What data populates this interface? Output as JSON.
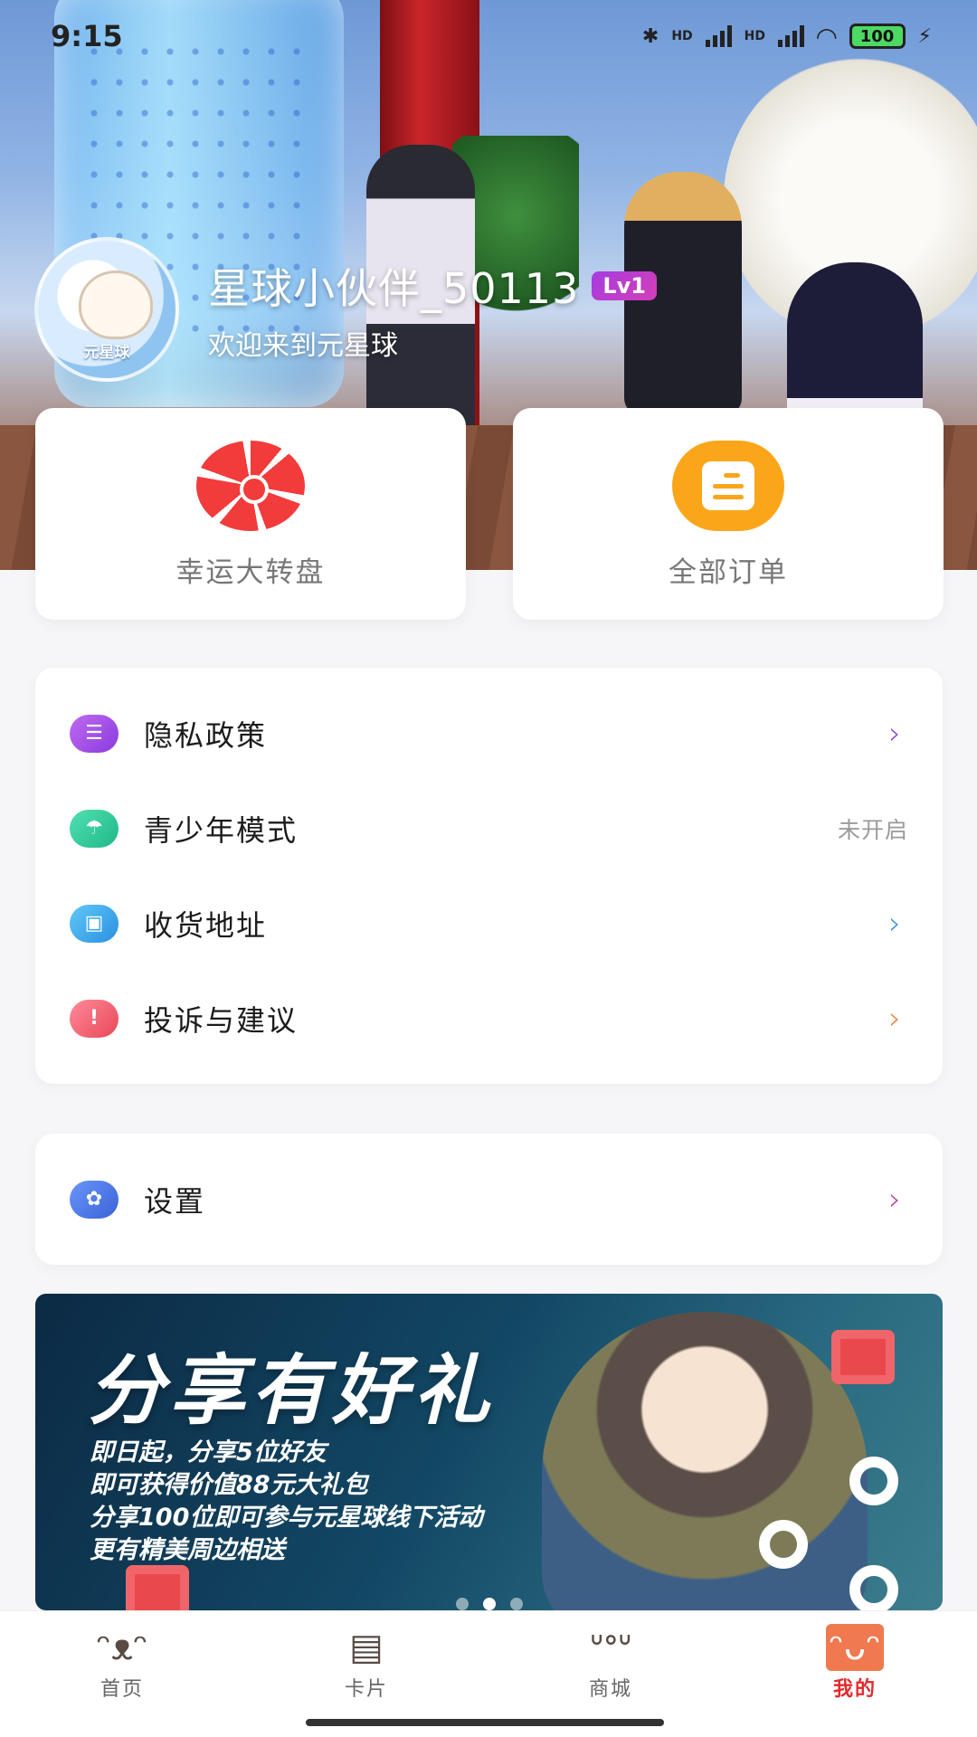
{
  "status_bar": {
    "time": "9:15",
    "battery": "100",
    "network_labels": [
      "HD",
      "HD"
    ]
  },
  "profile": {
    "username": "星球小伙伴_50113",
    "level": "Lv1",
    "welcome": "欢迎来到元星球",
    "avatar_logo_text": "元星球"
  },
  "quick_actions": [
    {
      "label": "幸运大转盘",
      "icon": "wheel-icon",
      "color": "#f23b3b"
    },
    {
      "label": "全部订单",
      "icon": "orders-icon",
      "color": "#fba61a"
    }
  ],
  "menu": {
    "items": [
      {
        "label": "隐私政策",
        "value": "",
        "icon": "privacy-icon",
        "icon_color": "#a04ae8",
        "chevron_color": "#8a45d8"
      },
      {
        "label": "青少年模式",
        "value": "未开启",
        "icon": "umbrella-icon",
        "icon_color": "#2ec89a",
        "chevron_color": ""
      },
      {
        "label": "收货地址",
        "value": "",
        "icon": "address-book-icon",
        "icon_color": "#3aa0e8",
        "chevron_color": "#3a8ee0"
      },
      {
        "label": "投诉与建议",
        "value": "",
        "icon": "warning-icon",
        "icon_color": "#f06070",
        "chevron_color": "#f08040"
      }
    ],
    "settings": {
      "label": "设置",
      "icon": "gear-icon",
      "icon_color": "#3f6fe0",
      "chevron_color": "#c03aa0"
    }
  },
  "banner": {
    "title": "分享有好礼",
    "lines": [
      "即日起，分享5位好友",
      "即可获得价值88元大礼包",
      "分享100位即可参与元星球线下活动",
      "更有精美周边相送"
    ],
    "slides_count": 3,
    "active_slide": 2
  },
  "bottom_nav": {
    "items": [
      {
        "label": "首页",
        "icon": "home-cat-icon",
        "active": false
      },
      {
        "label": "卡片",
        "icon": "cards-icon",
        "active": false
      },
      {
        "label": "商城",
        "icon": "shop-dog-icon",
        "active": false
      },
      {
        "label": "我的",
        "icon": "profile-bunny-icon",
        "active": true
      }
    ],
    "active_color": "#e4292b"
  }
}
